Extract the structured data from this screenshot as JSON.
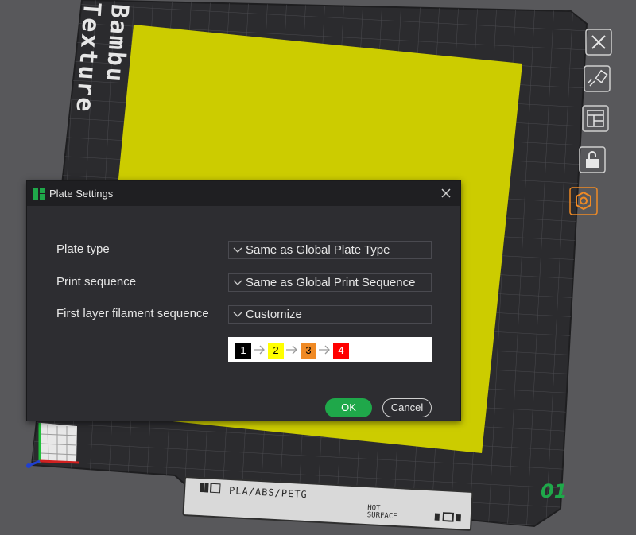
{
  "scene": {
    "plate_brand_text": "Bambu Texture",
    "plate_footer_material": "PLA/ABS/PETG",
    "plate_footer_warning_line1": "HOT",
    "plate_footer_warning_line2": "SURFACE",
    "plate_number": "01",
    "colors": {
      "background": "#58585b",
      "plate": "#2b2b2e",
      "model": "#cccc00",
      "accent_orange": "#f08a24",
      "accent_green": "#1fa84a"
    }
  },
  "toolbar": {
    "close_icon": "close-icon",
    "paint_icon": "brush-icon",
    "arrange_icon": "layout-icon",
    "lock_icon": "unlock-icon",
    "settings_icon": "hexagon-gear-icon"
  },
  "dialog": {
    "title": "Plate Settings",
    "rows": [
      {
        "label": "Plate type",
        "value": "Same as Global Plate Type"
      },
      {
        "label": "Print sequence",
        "value": "Same as Global Print Sequence"
      },
      {
        "label": "First layer filament sequence",
        "value": "Customize"
      }
    ],
    "sequence": [
      {
        "label": "1",
        "color": "#000000",
        "text_color": "#ffffff"
      },
      {
        "label": "2",
        "color": "#ffff00",
        "text_color": "#000000"
      },
      {
        "label": "3",
        "color": "#f08a24",
        "text_color": "#000000"
      },
      {
        "label": "4",
        "color": "#ff0000",
        "text_color": "#ffffff"
      }
    ],
    "ok_label": "OK",
    "cancel_label": "Cancel"
  }
}
